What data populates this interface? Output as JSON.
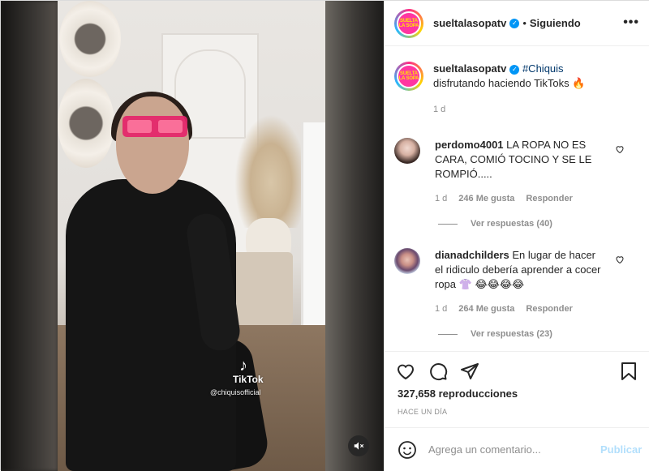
{
  "header": {
    "username": "sueltalasopatv",
    "separator": "•",
    "follow_status": "Siguiendo",
    "more_icon": "more-options-icon",
    "avatar_text": "SUELTA LA SOPA"
  },
  "caption": {
    "username": "sueltalasopatv",
    "hashtag": "#Chiquis",
    "text": "disfrutando haciendo TikToks",
    "emoji": "🔥",
    "time": "1 d"
  },
  "comments": [
    {
      "username": "perdomo4001",
      "text": "LA ROPA NO ES CARA, COMIÓ TOCINO Y SE LE ROMPIÓ.....",
      "time": "1 d",
      "likes": "246 Me gusta",
      "reply": "Responder",
      "view_replies": "Ver respuestas (40)"
    },
    {
      "username": "dianadchilders",
      "text": "En lugar de hacer el ridiculo debería aprender a cocer ropa",
      "emojis": "👚 😂😂😂😂",
      "time": "1 d",
      "likes": "264 Me gusta",
      "reply": "Responder",
      "view_replies": "Ver respuestas (23)"
    }
  ],
  "media": {
    "watermark": "TikTok",
    "handle": "@chiquisofficial"
  },
  "stats": {
    "views": "327,658 reproducciones",
    "posted": "HACE UN DÍA"
  },
  "comment_box": {
    "placeholder": "Agrega un comentario...",
    "publish": "Publicar"
  },
  "colors": {
    "verified": "#0095f6",
    "publish_disabled": "#b2dffc",
    "meta_gray": "#8e8e8e"
  }
}
